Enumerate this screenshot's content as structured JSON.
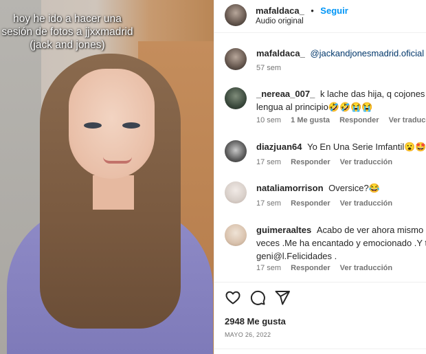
{
  "post": {
    "caption_lines": [
      "hoy he ido a hacer una",
      "sesión de fotos a jjxxmadrid",
      "(jack and jones)"
    ]
  },
  "header": {
    "username": "mafaldaca_",
    "separator": "•",
    "follow_label": "Seguir",
    "audio": "Audio original"
  },
  "comments": [
    {
      "username": "mafaldaca_",
      "lines": [
        "@jackandjonesmadrid.oficial @_"
      ],
      "time": "57 sem",
      "likes": "",
      "reply": "",
      "translate": "",
      "is_owner_caption": true
    },
    {
      "username": "_nereaa_007_",
      "lines": [
        "k lache das hija, q cojones hac",
        "lengua al principio🤣🤣😭😭"
      ],
      "time": "10 sem",
      "likes": "1 Me gusta",
      "reply": "Responder",
      "translate": "Ver traducción"
    },
    {
      "username": "diazjuan64",
      "lines": [
        "Yo En Una Serie Imfantil😮🤩🔥"
      ],
      "time": "17 sem",
      "likes": "",
      "reply": "Responder",
      "translate": "Ver traducción"
    },
    {
      "username": "nataliamorrison",
      "lines": [
        "Oversice?😂"
      ],
      "time": "17 sem",
      "likes": "",
      "reply": "Responder",
      "translate": "Ver traducción"
    },
    {
      "username": "guimeraaltes",
      "lines": [
        "Acabo de ver ahora mismo la",
        "veces .Me ha encantado y emocionado .Y tu",
        "geni@l.Felicidades ."
      ],
      "time": "17 sem",
      "likes": "",
      "reply": "Responder",
      "translate": "Ver traducción"
    }
  ],
  "actions": {
    "like_icon": "heart-icon",
    "comment_icon": "comment-icon",
    "share_icon": "share-icon",
    "likes_count": "2948 Me gusta",
    "date": "MAYO 26, 2022"
  },
  "colors": {
    "follow_blue": "#0095f6",
    "meta_gray": "#737373",
    "text": "#262626",
    "sweater": "#8f8bc7"
  }
}
